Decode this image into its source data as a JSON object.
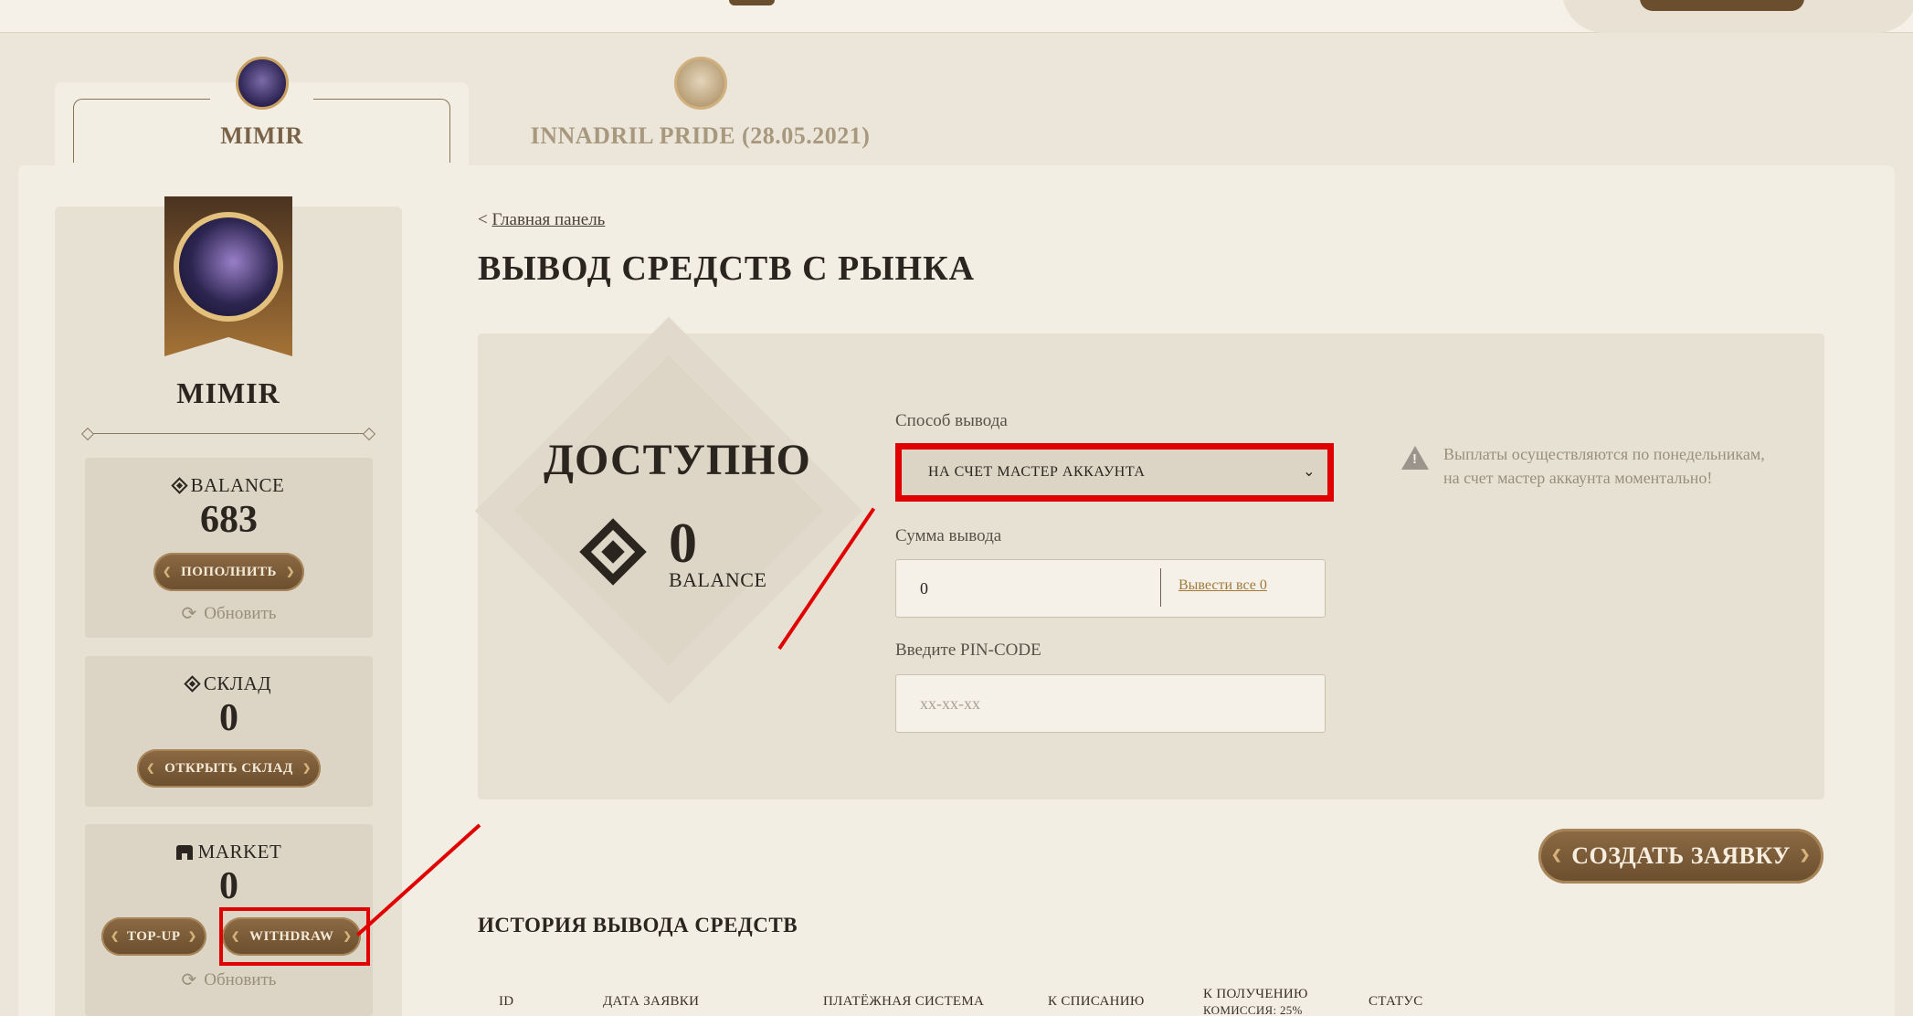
{
  "servers": [
    {
      "name": "MIMIR",
      "active": true
    },
    {
      "name": "INNADRIL PRIDE (28.05.2021)",
      "active": false
    }
  ],
  "profile": {
    "name": "MIMIR"
  },
  "balance_card": {
    "title": "BALANCE",
    "value": "683",
    "button": "ПОПОЛНИТЬ",
    "refresh": "Обновить"
  },
  "warehouse_card": {
    "title": "СКЛАД",
    "value": "0",
    "button": "ОТКРЫТЬ СКЛАД"
  },
  "market_card": {
    "title": "MARKET",
    "value": "0",
    "topup": "TOP-UP",
    "withdraw": "WITHDRAW",
    "refresh": "Обновить"
  },
  "breadcrumb": {
    "prefix": "<",
    "link": "Главная панель"
  },
  "page_title": "ВЫВОД СРЕДСТВ С РЫНКА",
  "available": {
    "title": "ДОСТУПНО",
    "value": "0",
    "unit": "BALANCE"
  },
  "form": {
    "method_label": "Способ вывода",
    "method_value": "НА СЧЕТ МАСТЕР АККАУНТА",
    "amount_label": "Сумма вывода",
    "amount_value": "0",
    "withdraw_all": "Вывести все 0",
    "pin_label": "Введите PIN-CODE",
    "pin_placeholder": "xx-xx-xx"
  },
  "notice": "Выплаты осуществляются по понедельникам, на счет мастер аккаунта моментально!",
  "create_button": "СОЗДАТЬ ЗАЯВКУ",
  "history": {
    "title": "ИСТОРИЯ ВЫВОДА СРЕДСТВ",
    "columns": [
      "ID",
      "ДАТА ЗАЯВКИ",
      "ПЛАТЁЖНАЯ СИСТЕМА",
      "К СПИСАНИЮ",
      "К ПОЛУЧЕНИЮ",
      "КОМИССИЯ: 25%",
      "СТАТУС"
    ]
  },
  "colors": {
    "accent": "#6b4e2e",
    "highlight": "#e00000",
    "background": "#ece6da"
  }
}
